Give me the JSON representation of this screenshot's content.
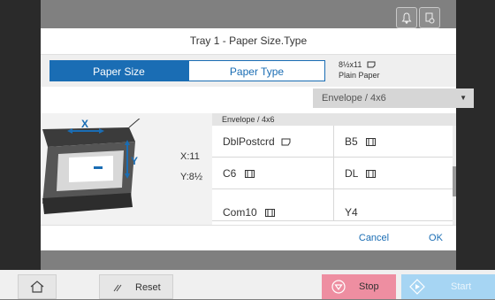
{
  "dialog": {
    "title": "Tray 1 - Paper Size.Type",
    "tabs": [
      {
        "label": "Paper Size",
        "active": true
      },
      {
        "label": "Paper Type",
        "active": false
      }
    ],
    "current_size": "8½x11",
    "current_type": "Plain Paper",
    "dropdown": {
      "value": "Envelope / 4x6"
    },
    "illustration": {
      "x_label": "X:11",
      "y_label": "Y:8½"
    },
    "list": {
      "header": "Envelope / 4x6",
      "items": [
        {
          "label": "DblPostcrd",
          "icon": "portrait-paper-icon"
        },
        {
          "label": "B5",
          "icon": "envelope-icon"
        },
        {
          "label": "C6",
          "icon": "envelope-icon"
        },
        {
          "label": "DL",
          "icon": "envelope-icon"
        },
        {
          "label": "Com10",
          "icon": "envelope-icon"
        },
        {
          "label": "Y4",
          "icon": ""
        }
      ]
    },
    "footer": {
      "cancel": "Cancel",
      "ok": "OK"
    }
  },
  "bottom_bar": {
    "reset": "Reset",
    "stop": "Stop",
    "start": "Start"
  },
  "colors": {
    "accent": "#1a6db4",
    "stop": "#ee8ea1",
    "start": "#a6d5f3"
  }
}
